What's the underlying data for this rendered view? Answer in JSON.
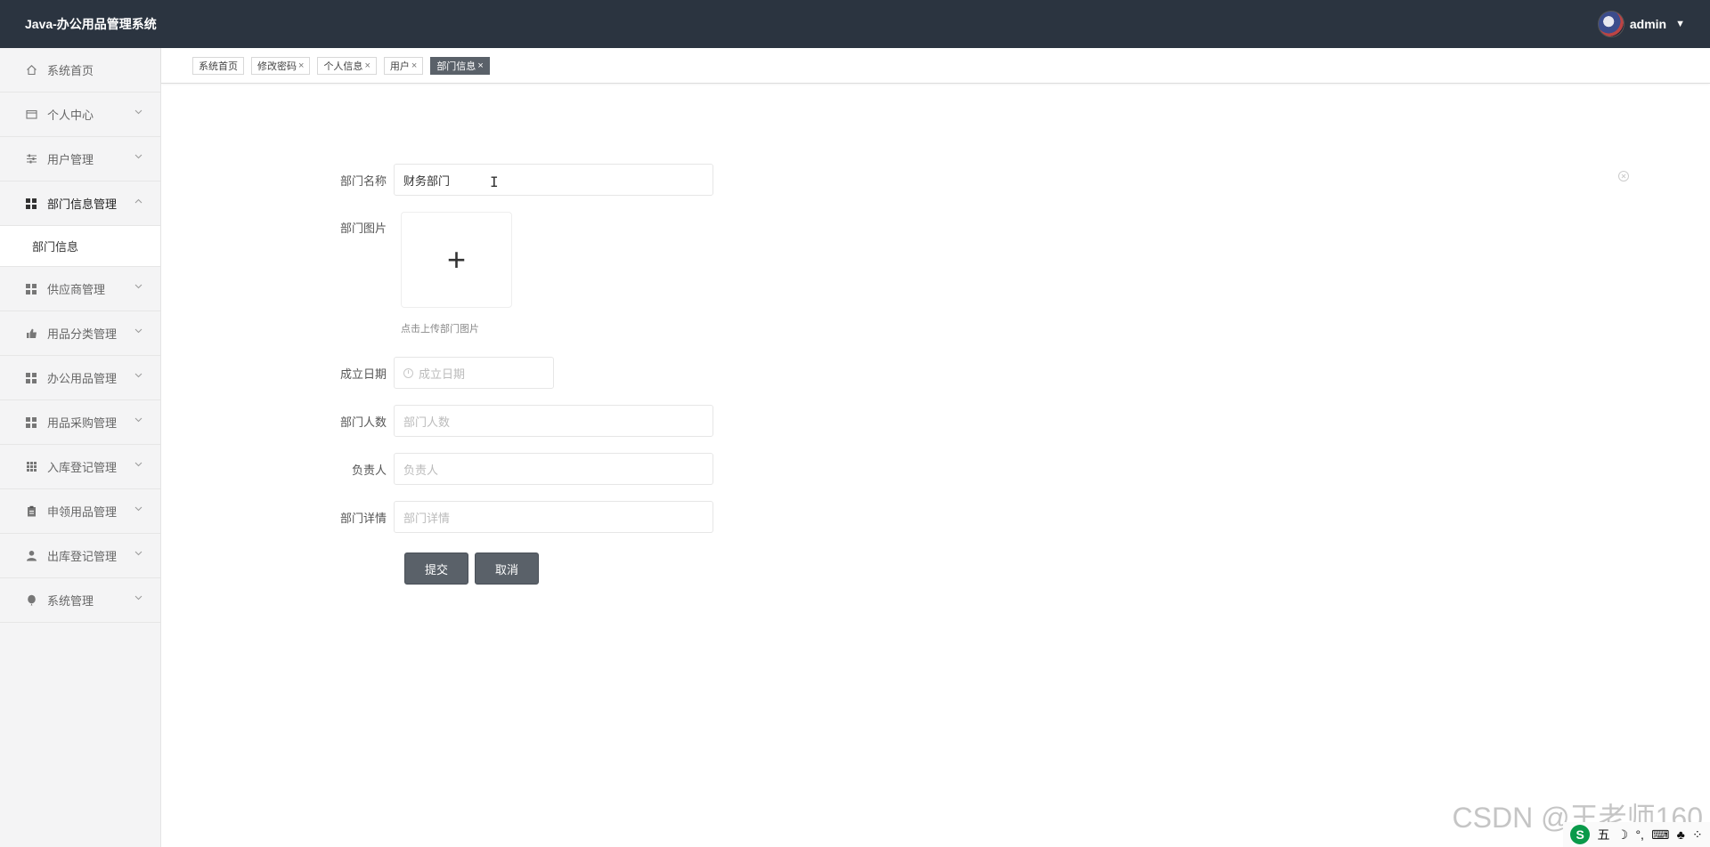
{
  "header": {
    "title": "Java-办公用品管理系统",
    "username": "admin",
    "caret": "▼"
  },
  "sidebar": {
    "items": [
      {
        "label": "系统首页",
        "icon": "home-icon"
      },
      {
        "label": "个人中心",
        "icon": "card-icon"
      },
      {
        "label": "用户管理",
        "icon": "sliders-icon"
      },
      {
        "label": "部门信息管理",
        "icon": "grid-icon",
        "expanded": true
      },
      {
        "label": "部门信息",
        "sub": true
      },
      {
        "label": "供应商管理",
        "icon": "grid-icon"
      },
      {
        "label": "用品分类管理",
        "icon": "thumb-icon"
      },
      {
        "label": "办公用品管理",
        "icon": "grid-icon"
      },
      {
        "label": "用品采购管理",
        "icon": "grid-icon"
      },
      {
        "label": "入库登记管理",
        "icon": "grid9-icon"
      },
      {
        "label": "申领用品管理",
        "icon": "clipboard-icon"
      },
      {
        "label": "出库登记管理",
        "icon": "user-icon"
      },
      {
        "label": "系统管理",
        "icon": "balloon-icon"
      }
    ]
  },
  "tabs": [
    {
      "label": "系统首页",
      "closable": false
    },
    {
      "label": "修改密码",
      "closable": true
    },
    {
      "label": "个人信息",
      "closable": true
    },
    {
      "label": "用户",
      "closable": true
    },
    {
      "label": "部门信息",
      "closable": true,
      "active": true
    }
  ],
  "close_glyph": "×",
  "form": {
    "dept_name": {
      "label": "部门名称",
      "value": "财务部门"
    },
    "dept_image": {
      "label": "部门图片",
      "hint": "点击上传部门图片",
      "plus": "+"
    },
    "founded_date": {
      "label": "成立日期",
      "placeholder": "成立日期"
    },
    "headcount": {
      "label": "部门人数",
      "placeholder": "部门人数"
    },
    "manager": {
      "label": "负责人",
      "placeholder": "负责人"
    },
    "details": {
      "label": "部门详情",
      "placeholder": "部门详情"
    },
    "submit_label": "提交",
    "cancel_label": "取消"
  },
  "watermark": "CSDN @王老师160",
  "tray": {
    "logo": "S",
    "items": [
      "五",
      "☽",
      "°,",
      "⌨",
      "♣",
      "⁘"
    ]
  },
  "colors": {
    "header_bg": "#2b3440",
    "sidebar_bg": "#f4f4f5",
    "active_tab": "#5a6169",
    "button": "#5a6169"
  }
}
